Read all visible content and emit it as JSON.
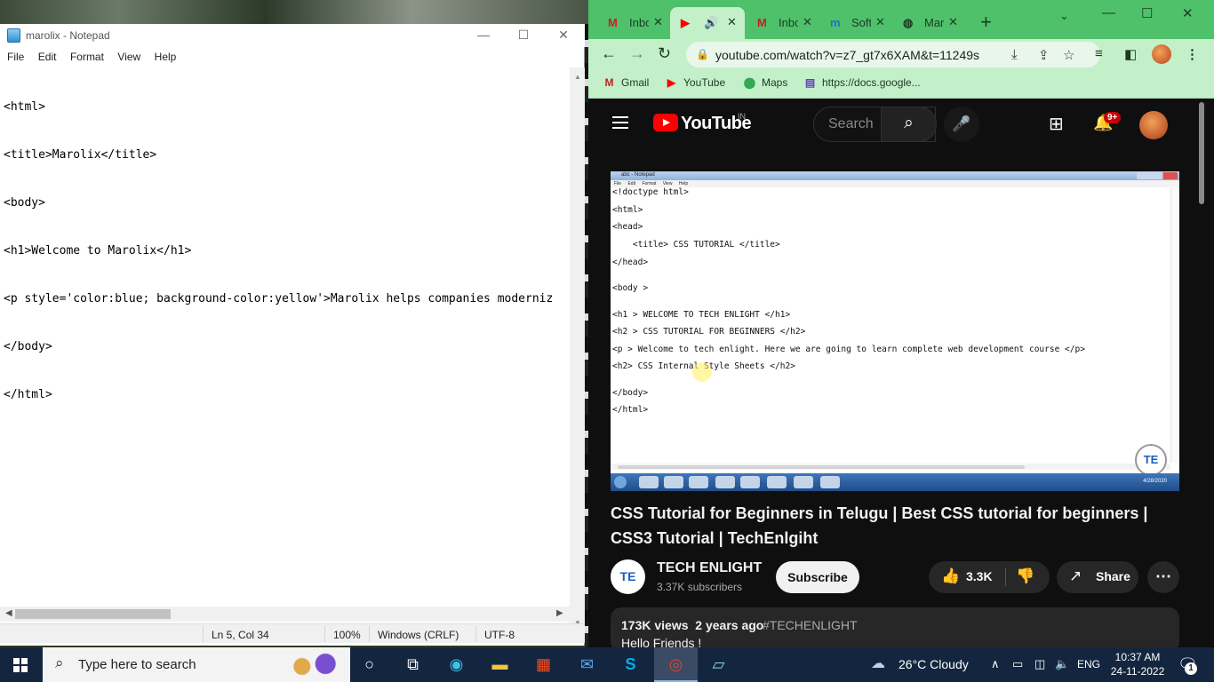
{
  "notepad": {
    "title": "marolix - Notepad",
    "controls": {
      "minimize": "—",
      "maximize": "☐",
      "close": "✕"
    },
    "menu": [
      "File",
      "Edit",
      "Format",
      "View",
      "Help"
    ],
    "lines": [
      "<html>",
      "<title>Marolix</title>",
      "<body>",
      "<h1>Welcome to Marolix</h1>",
      "<p style='color:blue; background-color:yellow'>Marolix helps companies moderniz",
      "</body>",
      "</html>"
    ],
    "status": {
      "position": "Ln 5, Col 34",
      "zoom": "100%",
      "line_ending": "Windows (CRLF)",
      "encoding": "UTF-8"
    }
  },
  "browser": {
    "tabs": [
      {
        "favicon": "gmail-icon",
        "label": "Inbo",
        "active": false
      },
      {
        "favicon": "youtube-icon",
        "label": "",
        "active": true,
        "audio": true
      },
      {
        "favicon": "gmail-icon",
        "label": "Inbo",
        "active": false
      },
      {
        "favicon": "marolix-icon",
        "label": "Soft",
        "active": false
      },
      {
        "favicon": "globe-icon",
        "label": "Mar",
        "active": false
      }
    ],
    "url": "youtube.com/watch?v=z7_gt7x6XAM&t=11249s",
    "bookmarks": [
      {
        "icon": "gmail-icon",
        "label": "Gmail"
      },
      {
        "icon": "youtube-icon",
        "label": "YouTube"
      },
      {
        "icon": "maps-icon",
        "label": "Maps"
      },
      {
        "icon": "docs-icon",
        "label": "https://docs.google..."
      }
    ],
    "accent_color": "#4ec16a"
  },
  "youtube": {
    "logo_text": "YouTube",
    "region": "IN",
    "search_placeholder": "Search",
    "notification_count": "9+",
    "video": {
      "notepad_title": "abc - Notepad",
      "notepad_menu": [
        "File",
        "Edit",
        "Format",
        "View",
        "Help"
      ],
      "code_lines": [
        "<!doctype html>",
        "<html>",
        "<head>",
        "    <title> CSS TUTORIAL </title>",
        "</head>",
        "<body >",
        "<h1 > WELCOME TO TECH ENLIGHT </h1>",
        "<h2 > CSS TUTORIAL FOR BEGINNERS </h2>",
        "<p > Welcome to tech enlight. Here we are going to learn complete web development course </p>",
        "<h2> CSS Internal Style Sheets </h2>",
        "</body>",
        "</html>"
      ],
      "clock": "4/28/2020"
    },
    "title": "CSS Tutorial for Beginners in Telugu | Best CSS tutorial for beginners | CSS3 Tutorial | TechEnlgiht",
    "channel": {
      "name": "TECH ENLIGHT",
      "subscribers": "3.37K subscribers",
      "avatar_text": "TE"
    },
    "subscribe_label": "Subscribe",
    "likes": "3.3K",
    "share_label": "Share",
    "views": "173K views",
    "age": "2 years ago",
    "hashtag": "#TECHENLIGHT",
    "description": "Hello Friends !"
  },
  "taskbar": {
    "search_placeholder": "Type here to search",
    "apps": [
      "cortana-icon",
      "task-view-icon",
      "edge-icon",
      "file-explorer-icon",
      "store-icon",
      "mail-icon",
      "skype-icon",
      "chrome-icon",
      "notepad-icon"
    ],
    "weather": "26°C  Cloudy",
    "language": "ENG",
    "time": "10:37 AM",
    "date": "24-11-2022",
    "notifications": "1"
  }
}
